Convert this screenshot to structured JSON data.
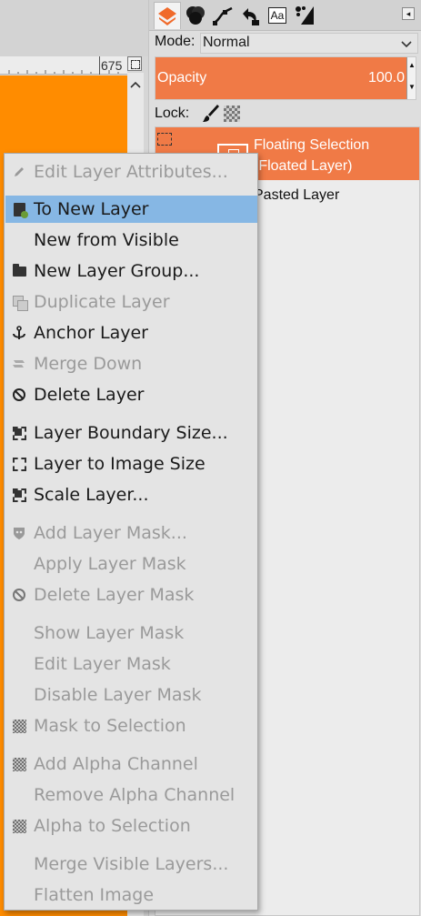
{
  "canvas": {
    "ruler_label": "675",
    "image_color": "#ff8c00"
  },
  "dock": {
    "tabs": [
      {
        "name": "layers",
        "icon": "layers-icon"
      },
      {
        "name": "channels",
        "icon": "channels-icon"
      },
      {
        "name": "paths",
        "icon": "paths-icon"
      },
      {
        "name": "undo-history",
        "icon": "undo-history-icon"
      },
      {
        "name": "fonts",
        "icon": "fonts-icon",
        "glyph": "Aa"
      },
      {
        "name": "brushes",
        "icon": "brushes-icon"
      }
    ],
    "mode": {
      "label": "Mode:",
      "value": "Normal"
    },
    "opacity": {
      "label": "Opacity",
      "value": "100.0"
    },
    "lock": {
      "label": "Lock:"
    },
    "layers": [
      {
        "name_line1": "Floating Selection",
        "name_line2": "(Floated Layer)",
        "selected": true
      },
      {
        "name": "Pasted Layer",
        "selected": false
      }
    ],
    "accent_color": "#f07a46"
  },
  "menu": {
    "items": [
      {
        "label": "Edit Layer Attributes...",
        "icon": "pencil-icon",
        "enabled": false
      },
      {
        "label": "To New Layer",
        "icon": "new-layer-icon",
        "enabled": true,
        "highlighted": true
      },
      {
        "label": "New from Visible",
        "icon": "",
        "enabled": true
      },
      {
        "label": "New Layer Group...",
        "icon": "folder-icon",
        "enabled": true
      },
      {
        "label": "Duplicate Layer",
        "icon": "duplicate-icon",
        "enabled": false
      },
      {
        "label": "Anchor Layer",
        "icon": "anchor-icon",
        "enabled": true
      },
      {
        "label": "Merge Down",
        "icon": "merge-down-icon",
        "enabled": false
      },
      {
        "label": "Delete Layer",
        "icon": "delete-icon",
        "enabled": true
      },
      {
        "label": "Layer Boundary Size...",
        "icon": "boundary-size-icon",
        "enabled": true
      },
      {
        "label": "Layer to Image Size",
        "icon": "layer-to-image-icon",
        "enabled": true
      },
      {
        "label": "Scale Layer...",
        "icon": "scale-icon",
        "enabled": true
      },
      {
        "label": "Add Layer Mask...",
        "icon": "mask-icon",
        "enabled": false
      },
      {
        "label": "Apply Layer Mask",
        "icon": "",
        "enabled": false
      },
      {
        "label": "Delete Layer Mask",
        "icon": "delete-icon",
        "enabled": false
      },
      {
        "label": "Show Layer Mask",
        "icon": "",
        "enabled": false
      },
      {
        "label": "Edit Layer Mask",
        "icon": "",
        "enabled": false
      },
      {
        "label": "Disable Layer Mask",
        "icon": "",
        "enabled": false
      },
      {
        "label": "Mask to Selection",
        "icon": "selection-icon",
        "enabled": false
      },
      {
        "label": "Add Alpha Channel",
        "icon": "alpha-icon",
        "enabled": false
      },
      {
        "label": "Remove Alpha Channel",
        "icon": "",
        "enabled": false
      },
      {
        "label": "Alpha to Selection",
        "icon": "selection-icon",
        "enabled": false
      },
      {
        "label": "Merge Visible Layers...",
        "icon": "",
        "enabled": false
      },
      {
        "label": "Flatten Image",
        "icon": "",
        "enabled": false
      }
    ],
    "highlight_color": "#86b7e4"
  }
}
